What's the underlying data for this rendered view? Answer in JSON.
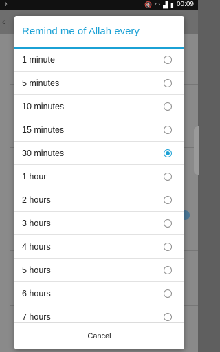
{
  "status_bar": {
    "time": "00:09",
    "icons": [
      "notification-icon",
      "mute-icon",
      "wifi-icon",
      "signal-icon",
      "battery-icon"
    ]
  },
  "dialog": {
    "title": "Remind me of Allah every",
    "options": [
      {
        "label": "1 minute",
        "selected": false
      },
      {
        "label": "5 minutes",
        "selected": false
      },
      {
        "label": "10 minutes",
        "selected": false
      },
      {
        "label": "15 minutes",
        "selected": false
      },
      {
        "label": "30 minutes",
        "selected": true
      },
      {
        "label": "1 hour",
        "selected": false
      },
      {
        "label": "2 hours",
        "selected": false
      },
      {
        "label": "3 hours",
        "selected": false
      },
      {
        "label": "4 hours",
        "selected": false
      },
      {
        "label": "5 hours",
        "selected": false
      },
      {
        "label": "6 hours",
        "selected": false
      },
      {
        "label": "7 hours",
        "selected": false
      }
    ],
    "cancel_label": "Cancel"
  },
  "colors": {
    "accent": "#1ba1d5",
    "overlay": "#5f5f5f"
  }
}
